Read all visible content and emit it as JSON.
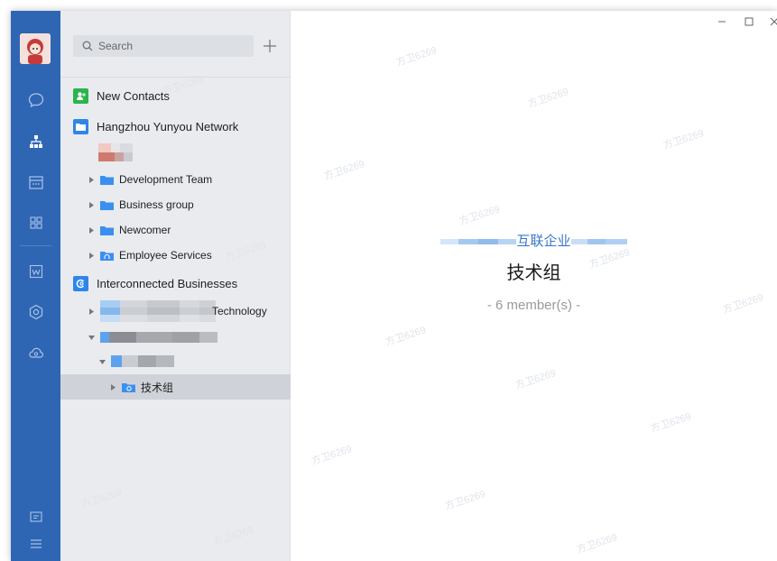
{
  "search": {
    "placeholder": "Search"
  },
  "sidebar": {
    "new_contacts": "New Contacts",
    "org_name": "Hangzhou Yunyou Network",
    "departments": [
      "Development Team",
      "Business group",
      "Newcomer",
      "Employee Services"
    ],
    "interconnected": "Interconnected Businesses",
    "tech_suffix": "Technology",
    "selected_group": "技术组"
  },
  "main": {
    "enterprise_suffix": "互联企业",
    "group_title": "技术组",
    "member_count": "- 6 member(s) -"
  },
  "watermark": "方卫6269",
  "colors": {
    "rail": "#2f66b3",
    "sidebar": "#e9ebef",
    "accent": "#3a78c9",
    "folder": "#3b8ff0",
    "green": "#2bb44d"
  }
}
